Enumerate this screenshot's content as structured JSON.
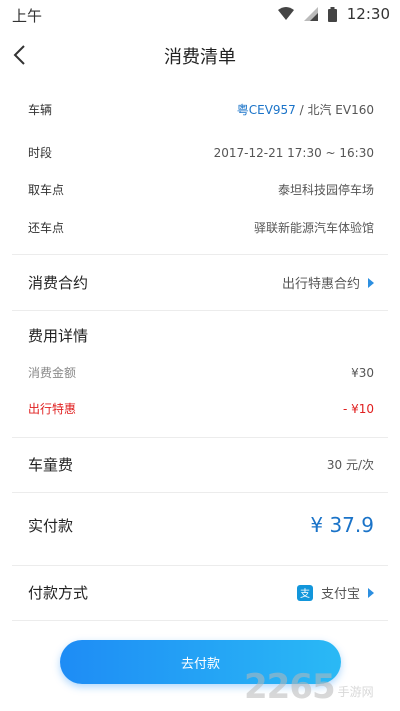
{
  "status_bar": {
    "left_text": "上午",
    "time": "12:30"
  },
  "nav": {
    "title": "消费清单"
  },
  "trip": {
    "vehicle_label": "车辆",
    "vehicle_plate": "粤CEV957",
    "vehicle_sep": " / ",
    "vehicle_model": "北汽 EV160",
    "period_label": "时段",
    "period_value": "2017-12-21 17:30 ~ 16:30",
    "pickup_label": "取车点",
    "pickup_value": "泰坦科技园停车场",
    "return_label": "还车点",
    "return_value": "驿联新能源汽车体验馆"
  },
  "contract": {
    "label": "消费合约",
    "value": "出行特惠合约"
  },
  "fees": {
    "title": "费用详情",
    "amount_label": "消费金额",
    "amount_value": "¥30",
    "discount_label": "出行特惠",
    "discount_value": "- ¥10"
  },
  "child_seat": {
    "label": "车童费",
    "value": "30 元/次"
  },
  "actual": {
    "label": "实付款",
    "value": "¥ 37.9"
  },
  "payment": {
    "label": "付款方式",
    "icon_glyph": "支",
    "value": "支付宝"
  },
  "button": {
    "label": "去付款"
  },
  "watermark": {
    "number": "2265",
    "text": "手游网"
  },
  "colors": {
    "accent": "#1a73c8",
    "discount": "#e02020",
    "button_start": "#1e8cf5",
    "button_end": "#2ab9f5"
  }
}
